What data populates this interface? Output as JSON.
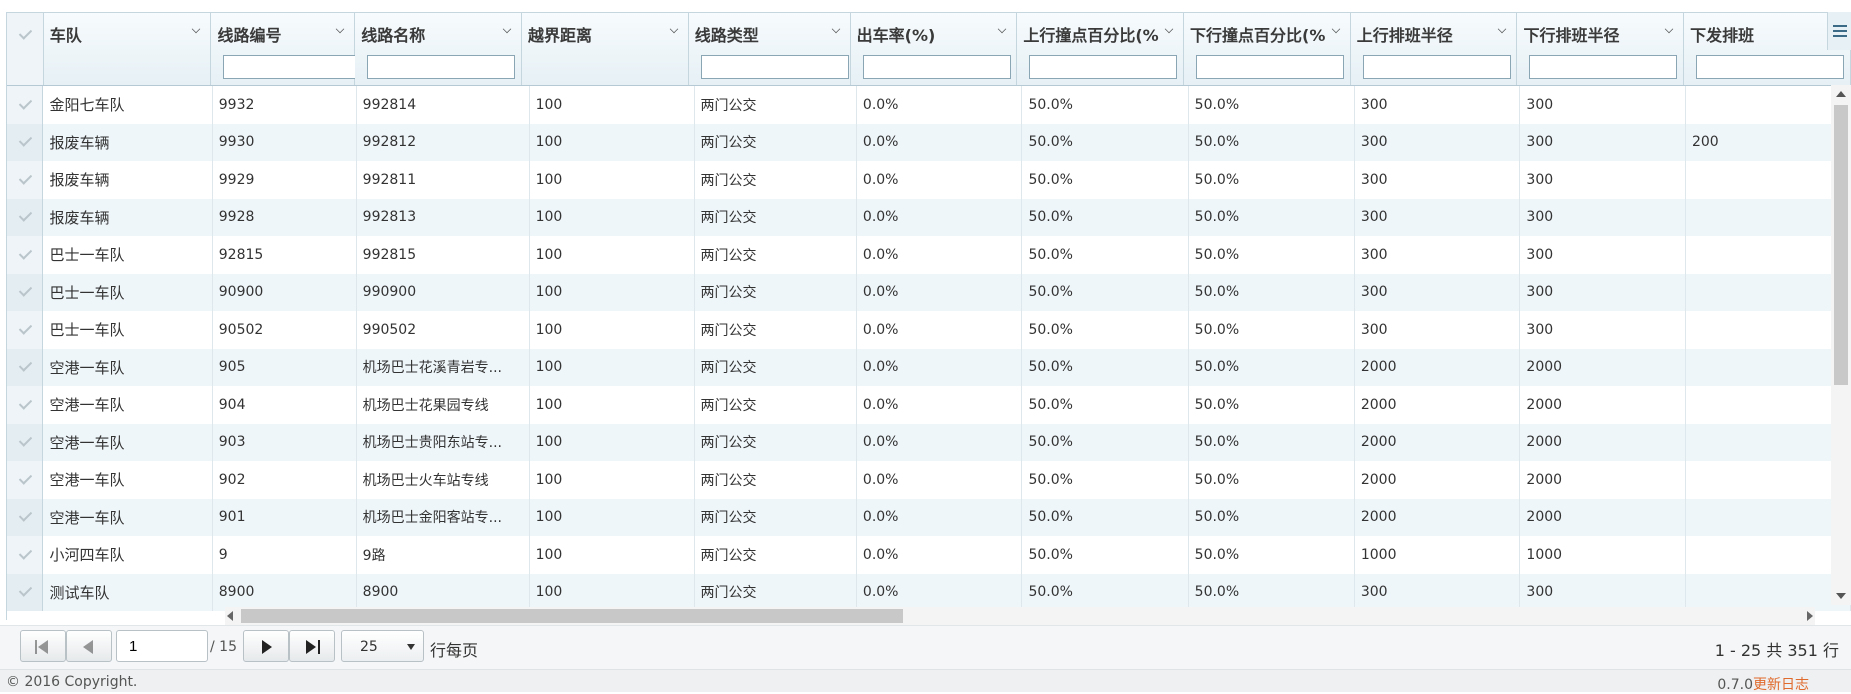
{
  "grid": {
    "columns": [
      "车队",
      "线路编号",
      "线路名称",
      "越界距离",
      "线路类型",
      "出车率(%)",
      "上行撞点百分比(%)",
      "下行撞点百分比(%)",
      "上行排班半径",
      "下行排班半径",
      "下发排班"
    ],
    "rows": [
      [
        "金阳七车队",
        "9932",
        "992814",
        "100",
        "两门公交",
        "0.0%",
        "50.0%",
        "50.0%",
        "300",
        "300",
        ""
      ],
      [
        "报废车辆",
        "9930",
        "992812",
        "100",
        "两门公交",
        "0.0%",
        "50.0%",
        "50.0%",
        "300",
        "300",
        "200"
      ],
      [
        "报废车辆",
        "9929",
        "992811",
        "100",
        "两门公交",
        "0.0%",
        "50.0%",
        "50.0%",
        "300",
        "300",
        ""
      ],
      [
        "报废车辆",
        "9928",
        "992813",
        "100",
        "两门公交",
        "0.0%",
        "50.0%",
        "50.0%",
        "300",
        "300",
        ""
      ],
      [
        "巴士一车队",
        "92815",
        "992815",
        "100",
        "两门公交",
        "0.0%",
        "50.0%",
        "50.0%",
        "300",
        "300",
        ""
      ],
      [
        "巴士一车队",
        "90900",
        "990900",
        "100",
        "两门公交",
        "0.0%",
        "50.0%",
        "50.0%",
        "300",
        "300",
        ""
      ],
      [
        "巴士一车队",
        "90502",
        "990502",
        "100",
        "两门公交",
        "0.0%",
        "50.0%",
        "50.0%",
        "300",
        "300",
        ""
      ],
      [
        "空港一车队",
        "905",
        "机场巴士花溪青岩专...",
        "100",
        "两门公交",
        "0.0%",
        "50.0%",
        "50.0%",
        "2000",
        "2000",
        ""
      ],
      [
        "空港一车队",
        "904",
        "机场巴士花果园专线",
        "100",
        "两门公交",
        "0.0%",
        "50.0%",
        "50.0%",
        "2000",
        "2000",
        ""
      ],
      [
        "空港一车队",
        "903",
        "机场巴士贵阳东站专...",
        "100",
        "两门公交",
        "0.0%",
        "50.0%",
        "50.0%",
        "2000",
        "2000",
        ""
      ],
      [
        "空港一车队",
        "902",
        "机场巴士火车站专线",
        "100",
        "两门公交",
        "0.0%",
        "50.0%",
        "50.0%",
        "2000",
        "2000",
        ""
      ],
      [
        "空港一车队",
        "901",
        "机场巴士金阳客站专...",
        "100",
        "两门公交",
        "0.0%",
        "50.0%",
        "50.0%",
        "2000",
        "2000",
        ""
      ],
      [
        "小河四车队",
        "9",
        "9路",
        "100",
        "两门公交",
        "0.0%",
        "50.0%",
        "50.0%",
        "1000",
        "1000",
        ""
      ],
      [
        "测试车队",
        "8900",
        "8900",
        "100",
        "两门公交",
        "0.0%",
        "50.0%",
        "50.0%",
        "300",
        "300",
        ""
      ]
    ]
  },
  "pager": {
    "page": "1",
    "of_total": "/ 15",
    "page_size": "25",
    "per_page_label": "行每页",
    "range_text": "1 - 25 共 351 行"
  },
  "footer": {
    "copyright": "© 2016 Copyright.",
    "version": "0.7.0",
    "changelog": "更新日志"
  },
  "icons": {
    "first": "first-page-icon",
    "prev": "prev-page-icon",
    "next": "next-page-icon",
    "last": "last-page-icon",
    "menu": "column-menu-icon",
    "check": "check-icon",
    "sort": "chevron-down-icon"
  },
  "colors": {
    "accent": "#3b6a86",
    "link": "#e06a2c",
    "row_alt": "#eff6fa",
    "header_bg": "#e6f0f5"
  }
}
